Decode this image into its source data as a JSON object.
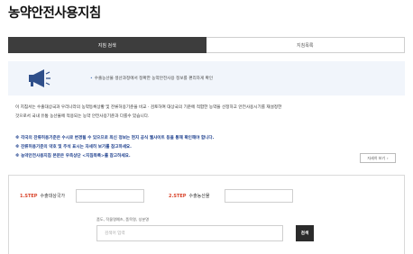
{
  "page": {
    "title": "농약안전사용지침"
  },
  "tabs": [
    {
      "label": "지침 검색",
      "active": true
    },
    {
      "label": "지침목록",
      "active": false
    }
  ],
  "notice": {
    "icon": "megaphone-icon",
    "text": "수출농산물 생산과정에서 정확한 농약안전사용 정보를 편리하게 확인"
  },
  "description": {
    "line1": "이 지침서는 수출대상국과 우리나라의 농약등록상황 및 잔류허용기준을 비교 · 검토하여 대상국의 기준에 적합한 농약을 선정하고 안전사용시기를 재설정한",
    "line2": "것으로서 국내 유통 농산물에 적용되는 농약 안전사용기준과 다를수 있습니다."
  },
  "notes": [
    "※ 각국의 잔류허용기준은 수시로 변경될 수 있으므로 최신 정보는 현지 공식 웹사이트 등을 통해 확인해야 합니다.",
    "※ 잔류허용기준의 약호 및 주석 표시는 자세히 보기를 참고하세요.",
    "※ 농약안전사용지침 본문은 우측상단 <지침목록>를 참고하세요."
  ],
  "more_button": {
    "label": "자세히 보기"
  },
  "steps": [
    {
      "no": "1.STEP",
      "label": "수출대상국가",
      "value": ""
    },
    {
      "no": "2.STEP",
      "label": "수출농산물",
      "value": ""
    }
  ],
  "search": {
    "caption": "품도, 작물명예츠, 품목명, 성분명",
    "placeholder": "검색어 입력",
    "button_label": "검색"
  },
  "colors": {
    "accent_red": "#d9442b",
    "notice_blue": "#1a3d8c",
    "tab_dark": "#3d3d3d",
    "notice_bg": "#f1f5fb"
  }
}
